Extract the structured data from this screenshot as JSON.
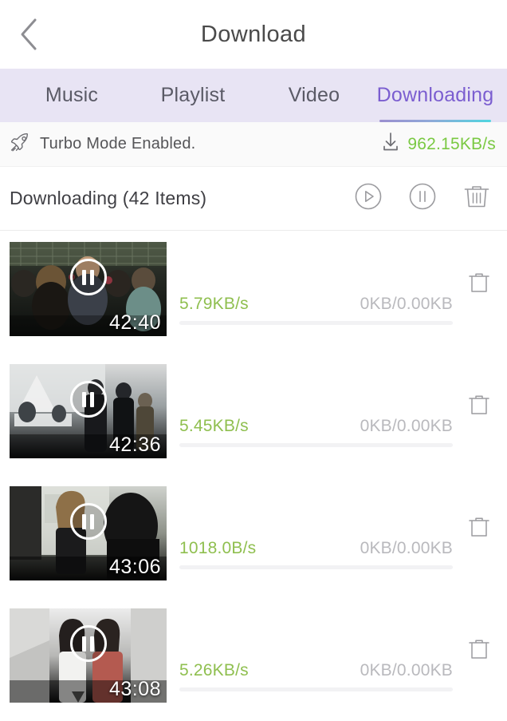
{
  "header": {
    "title": "Download",
    "back_icon": "chevron-left-icon"
  },
  "tabs": [
    {
      "label": "Music",
      "active": false
    },
    {
      "label": "Playlist",
      "active": false
    },
    {
      "label": "Video",
      "active": false
    },
    {
      "label": "Downloading",
      "active": true
    }
  ],
  "turbo": {
    "icon": "rocket-icon",
    "text": "Turbo Mode Enabled.",
    "download_icon": "download-arrow-icon",
    "total_speed": "962.15KB/s"
  },
  "section": {
    "title": "Downloading (42 Items)",
    "count": 42,
    "actions": [
      {
        "name": "resume-all-button",
        "icon": "play-circle-icon"
      },
      {
        "name": "pause-all-button",
        "icon": "pause-circle-icon"
      },
      {
        "name": "delete-all-button",
        "icon": "trash-icon"
      }
    ]
  },
  "items": [
    {
      "duration": "42:40",
      "speed": "5.79KB/s",
      "size": "0KB/0.00KB",
      "progress_percent": 0,
      "overlay_icon": "pause-icon",
      "delete_icon": "trash-icon",
      "thumb_kind": "crowd-indoor"
    },
    {
      "duration": "42:36",
      "speed": "5.45KB/s",
      "size": "0KB/0.00KB",
      "progress_percent": 0,
      "overlay_icon": "pause-icon",
      "delete_icon": "trash-icon",
      "thumb_kind": "hall-walk"
    },
    {
      "duration": "43:06",
      "speed": "1018.0B/s",
      "size": "0KB/0.00KB",
      "progress_percent": 0,
      "overlay_icon": "pause-icon",
      "delete_icon": "trash-icon",
      "thumb_kind": "woman-closeup"
    },
    {
      "duration": "43:08",
      "speed": "5.26KB/s",
      "size": "0KB/0.00KB",
      "progress_percent": 0,
      "overlay_icon": "pause-icon",
      "delete_icon": "trash-icon",
      "thumb_kind": "corridor-two"
    }
  ],
  "colors": {
    "accent_purple": "#7b5ed0",
    "tabbar_bg": "#e8e4f4",
    "speed_green": "#7ac943",
    "item_speed_green": "#8fbf4f",
    "muted_gray": "#b9b9bd",
    "underline_gradient_start": "#9b8fcf",
    "underline_gradient_end": "#4fd6e0"
  }
}
